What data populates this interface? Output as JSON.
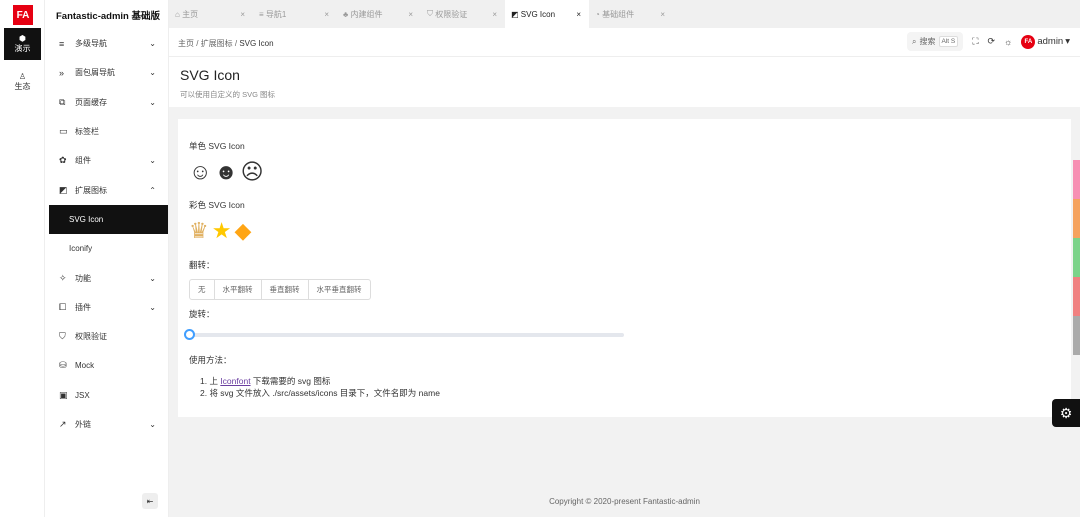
{
  "app": {
    "logo": "FA",
    "title": "Fantastic-admin 基础版"
  },
  "rail": [
    {
      "label": "演示",
      "icon": "cube-icon"
    },
    {
      "label": "生态",
      "icon": "ecosystem-icon"
    }
  ],
  "menu": [
    {
      "label": "多级导航",
      "icon": "≡"
    },
    {
      "label": "面包屑导航",
      "icon": "»"
    },
    {
      "label": "页面缓存",
      "icon": "⧉"
    },
    {
      "label": "标签栏",
      "icon": "▭"
    },
    {
      "label": "组件",
      "icon": "✿"
    },
    {
      "label": "扩展图标",
      "icon": "◩"
    },
    {
      "label": "SVG Icon"
    },
    {
      "label": "Iconify"
    },
    {
      "label": "功能",
      "icon": "✧"
    },
    {
      "label": "插件",
      "icon": "⧠"
    },
    {
      "label": "权限验证",
      "icon": "⛉"
    },
    {
      "label": "Mock",
      "icon": "⛁"
    },
    {
      "label": "JSX",
      "icon": "▣"
    },
    {
      "label": "外链",
      "icon": "↗"
    }
  ],
  "tabs": [
    {
      "label": "主页",
      "icon": "⌂"
    },
    {
      "label": "导航1",
      "icon": "≡"
    },
    {
      "label": "内建组件",
      "icon": "♣"
    },
    {
      "label": "权限验证",
      "icon": "⛉"
    },
    {
      "label": "SVG Icon",
      "icon": "◩"
    },
    {
      "label": "基础组件",
      "icon": "◔"
    }
  ],
  "breadcrumb": [
    "主页",
    "扩展图标",
    "SVG Icon"
  ],
  "toolbar": {
    "search": "搜索",
    "shortcut": "Alt S",
    "user": "admin",
    "avatar": "FA"
  },
  "page": {
    "title": "SVG Icon",
    "subtitle": "可以使用自定义的 SVG 图标"
  },
  "content": {
    "mono_label": "单色 SVG Icon",
    "color_label": "彩色 SVG Icon",
    "flip_label": "翻转：",
    "flip_options": [
      "无",
      "水平翻转",
      "垂直翻转",
      "水平垂直翻转"
    ],
    "rotate_label": "旋转：",
    "rotate_value": 0,
    "usage_label": "使用方法：",
    "usage_1_prefix": "1. 上 ",
    "usage_1_link": "Iconfont",
    "usage_1_suffix": " 下载需要的 svg 图标",
    "usage_2": "2. 将 svg 文件放入 ./src/assets/icons 目录下，文件名即为 name"
  },
  "footer": "Copyright © 2020-present  Fantastic-admin",
  "theme_colors": [
    "#f78fb3",
    "#f5a25d",
    "#7bd389",
    "#f08080",
    "#aaaaaa"
  ]
}
